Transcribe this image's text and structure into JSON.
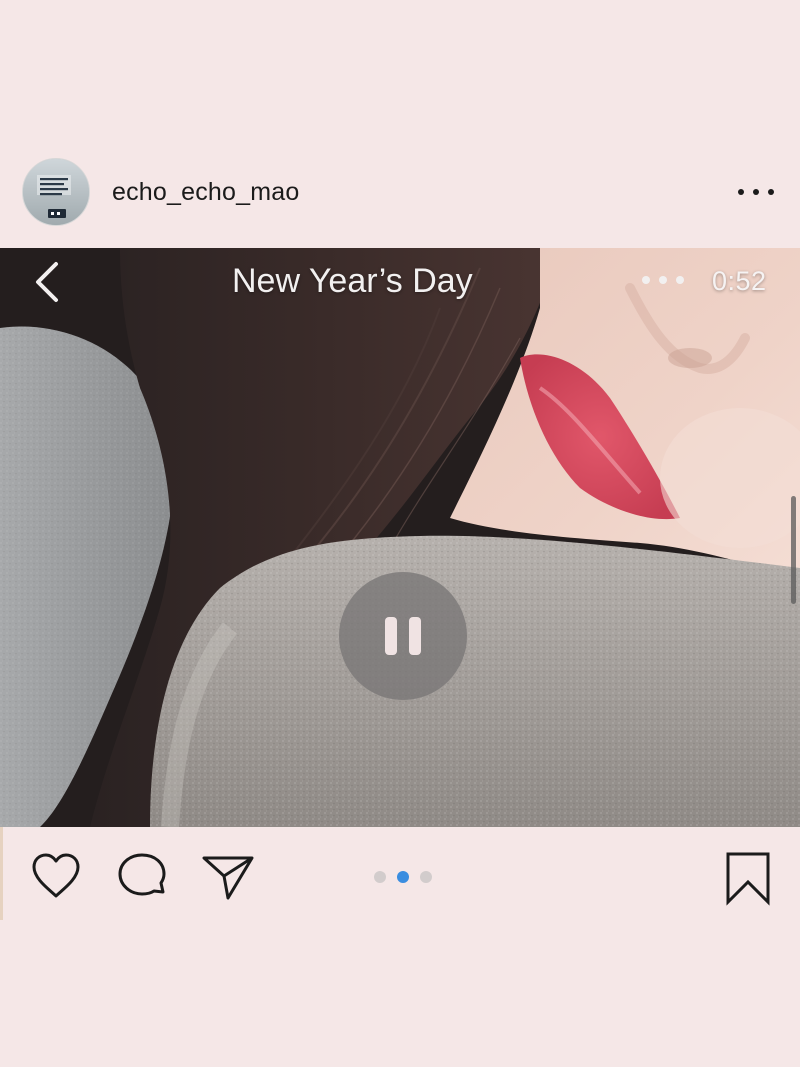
{
  "post": {
    "username": "echo_echo_mao",
    "avatar_caption": "OVERCOME, SOMEOVER, AND OVERCOME, AND SOMEOVER."
  },
  "video": {
    "title": "New Year’s Day",
    "time": "0:52",
    "paused": false
  },
  "carousel": {
    "total": 3,
    "active_index": 1
  },
  "icons": {
    "more": "more-horizontal-icon",
    "back": "chevron-left-icon",
    "play_state": "pause-icon",
    "like": "heart-icon",
    "comment": "comment-bubble-icon",
    "share": "paper-plane-icon",
    "save": "bookmark-icon"
  },
  "colors": {
    "background": "#f5e7e7",
    "text": "#1b1b1b",
    "active_dot": "#3a8de0",
    "inactive_dot": "#d2cccc"
  }
}
